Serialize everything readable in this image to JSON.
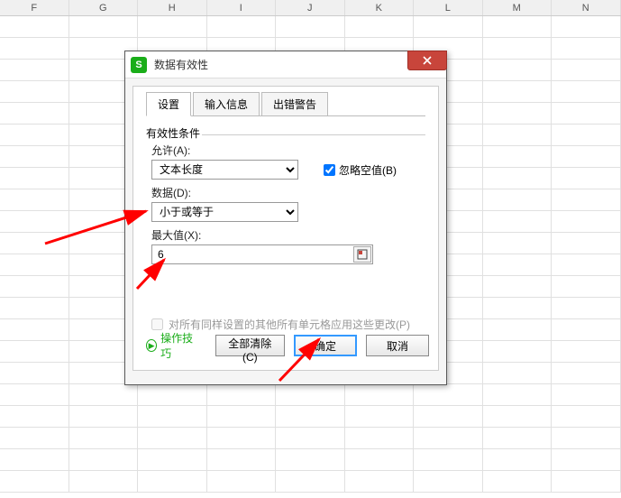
{
  "grid_columns": [
    "F",
    "G",
    "H",
    "I",
    "J",
    "K",
    "L",
    "M",
    "N"
  ],
  "dialog": {
    "title": "数据有效性",
    "tabs": {
      "settings": "设置",
      "input_msg": "输入信息",
      "error_alert": "出错警告"
    },
    "group_label": "有效性条件",
    "allow_label": "允许(A):",
    "allow_value": "文本长度",
    "ignore_blank_label": "忽略空值(B)",
    "ignore_blank_checked": true,
    "data_label": "数据(D):",
    "data_value": "小于或等于",
    "max_label": "最大值(X):",
    "max_value": "6",
    "apply_others_label": "对所有同样设置的其他所有单元格应用这些更改(P)",
    "tips_label": "操作技巧",
    "clear_all_label": "全部清除(C)",
    "ok_label": "确定",
    "cancel_label": "取消"
  }
}
